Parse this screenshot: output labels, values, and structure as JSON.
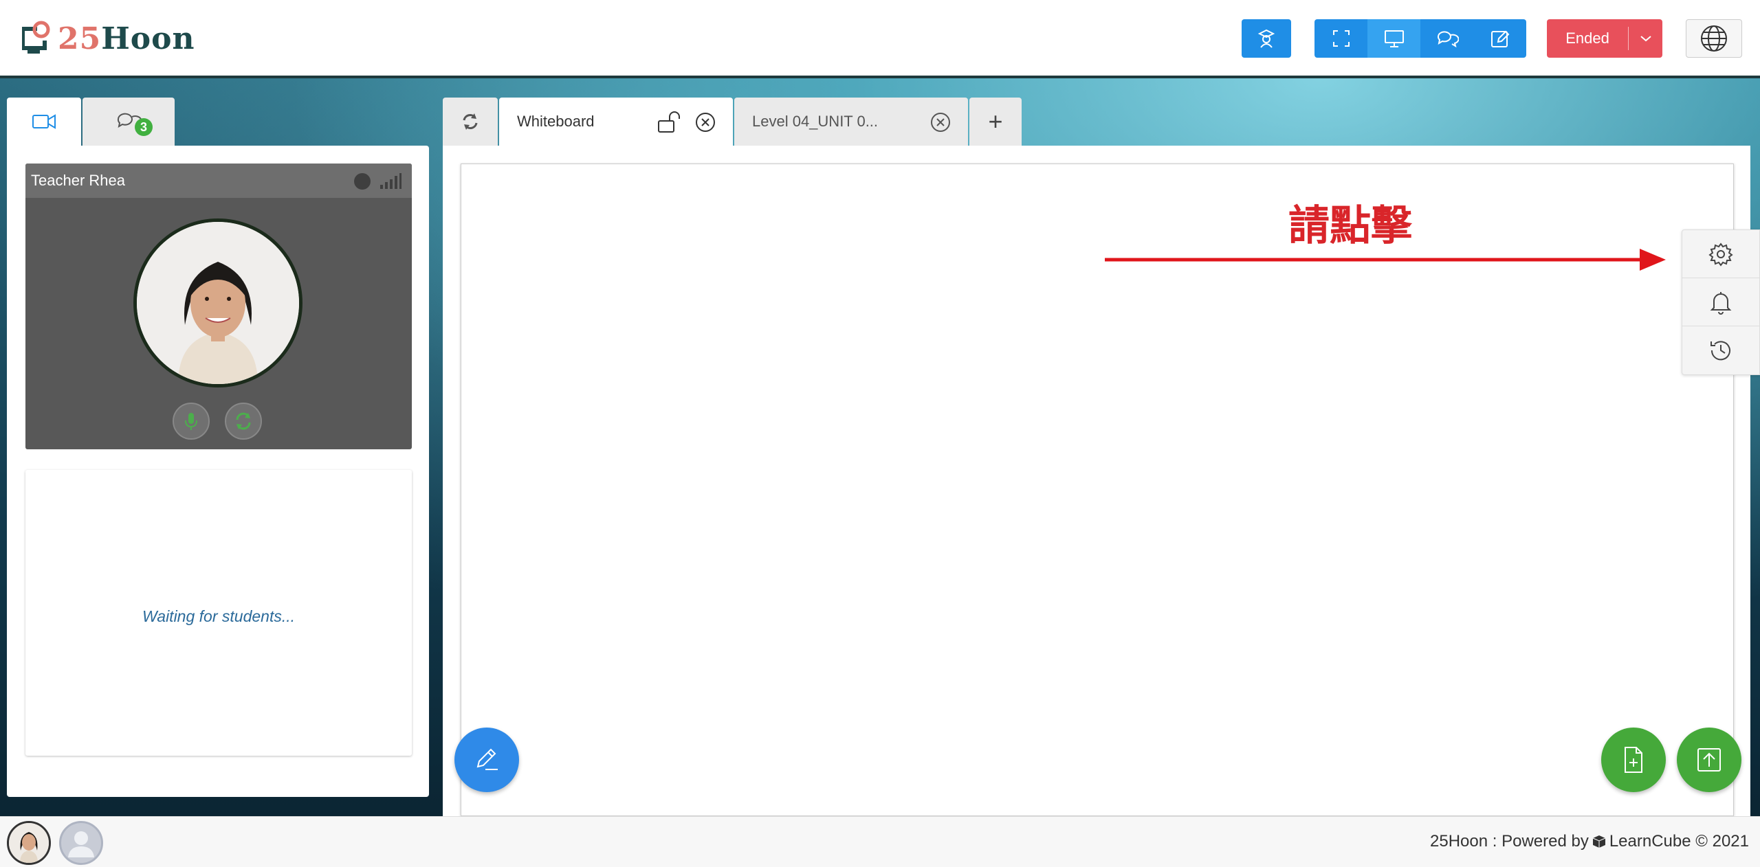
{
  "header": {
    "logo_number": "25",
    "logo_word": "Hoon",
    "status_label": "Ended"
  },
  "left_panel": {
    "messages_badge": "3",
    "teacher_name": "Teacher Rhea",
    "waiting_text": "Waiting for students..."
  },
  "whiteboard": {
    "tabs": [
      {
        "label": "Whiteboard"
      },
      {
        "label": "Level 04_UNIT 0..."
      }
    ],
    "add_tab_label": "+",
    "annotation_text": "請點擊"
  },
  "footer": {
    "text_prefix": "25Hoon : Powered by",
    "text_brand": "LearnCube © 2021"
  },
  "colors": {
    "primary_blue": "#1f8ee6",
    "ended_red": "#e8505b",
    "green": "#45a93a",
    "annotation_red": "#d9252a"
  }
}
